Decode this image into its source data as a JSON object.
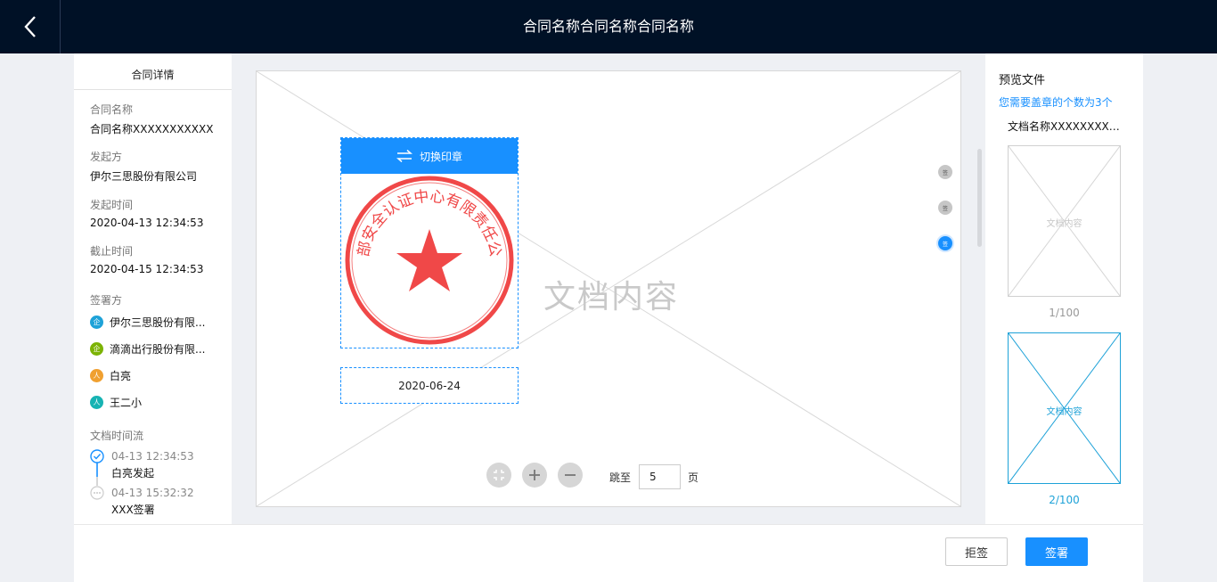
{
  "header": {
    "title": "合同名称合同名称合同名称",
    "back_icon": "chevron-left-icon"
  },
  "details": {
    "panel_title": "合同详情",
    "fields": [
      {
        "label": "合同名称",
        "value": "合同名称XXXXXXXXXXX"
      },
      {
        "label": "发起方",
        "value": "伊尔三思股份有限公司"
      },
      {
        "label": "发起时间",
        "value": "2020-04-13  12:34:53"
      },
      {
        "label": "截止时间",
        "value": "2020-04-15  12:34:53"
      }
    ],
    "signers_label": "签署方",
    "signers": [
      {
        "badge": "企",
        "name": "伊尔三思股份有限...",
        "color": "#1ea2d8"
      },
      {
        "badge": "企",
        "name": "滴滴出行股份有限...",
        "color": "#7cb305"
      },
      {
        "badge": "人",
        "name": "白亮",
        "color": "#f0a030"
      },
      {
        "badge": "人",
        "name": "王二小",
        "color": "#17b3b3"
      }
    ],
    "timeline_label": "文档时间流",
    "timeline": [
      {
        "time": "04-13 12:34:53",
        "desc": "白亮发起",
        "status": "done"
      },
      {
        "time": "04-13 15:32:32",
        "desc": "XXX签署",
        "status": "pending"
      }
    ]
  },
  "viewer": {
    "doc_text": "文档内容",
    "switch_seal_label": "切换印章",
    "seal": {
      "text": "西部安全认证中心有限责任公司",
      "color": "#f04848"
    },
    "date_value": "2020-06-24",
    "sig_marker_label": "签",
    "controls": {
      "fit_icon": "fullscreen-exit-icon",
      "zoom_in_icon": "plus-icon",
      "zoom_out_icon": "minus-icon"
    },
    "goto": {
      "prefix": "跳至",
      "value": "5",
      "suffix": "页"
    }
  },
  "preview": {
    "title": "预览文件",
    "note": "您需要盖章的个数为3个",
    "doc_name": "文档名称XXXXXXXXXXX",
    "thumbs": [
      {
        "text": "文档内容",
        "page": "1/100",
        "active": false
      },
      {
        "text": "文档内容",
        "page": "2/100",
        "active": true
      }
    ]
  },
  "footer": {
    "reject_label": "拒签",
    "sign_label": "签署"
  },
  "colors": {
    "primary": "#1890ff",
    "header_bg": "#001126",
    "seal_red": "#f04848"
  }
}
